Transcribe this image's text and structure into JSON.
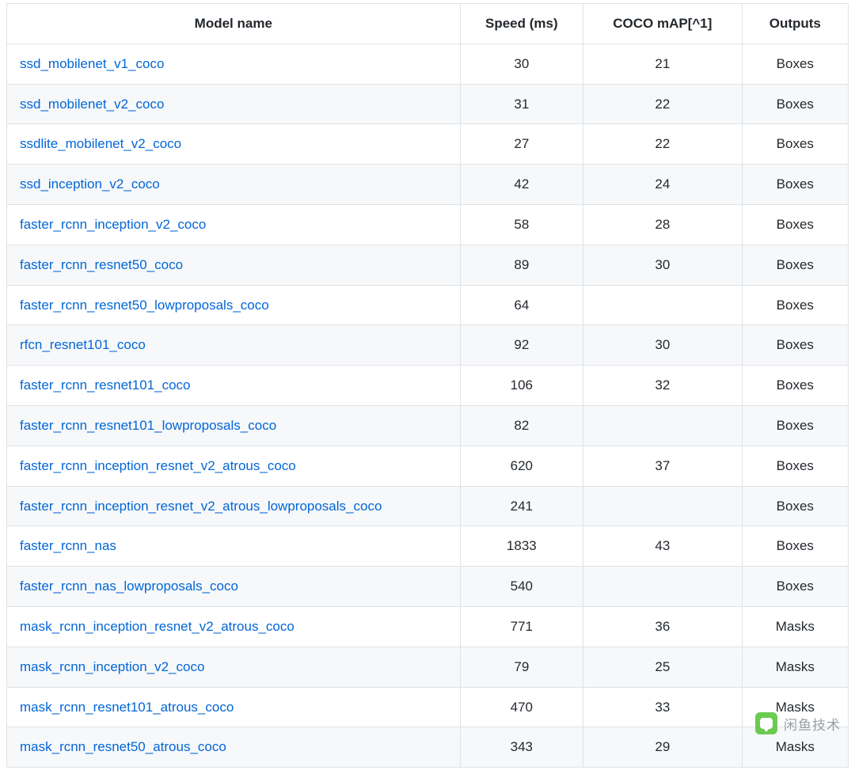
{
  "table": {
    "headers": {
      "name": "Model name",
      "speed": "Speed (ms)",
      "map": "COCO mAP[^1]",
      "outputs": "Outputs"
    },
    "rows": [
      {
        "name": "ssd_mobilenet_v1_coco",
        "speed": "30",
        "map": "21",
        "outputs": "Boxes"
      },
      {
        "name": "ssd_mobilenet_v2_coco",
        "speed": "31",
        "map": "22",
        "outputs": "Boxes"
      },
      {
        "name": "ssdlite_mobilenet_v2_coco",
        "speed": "27",
        "map": "22",
        "outputs": "Boxes"
      },
      {
        "name": "ssd_inception_v2_coco",
        "speed": "42",
        "map": "24",
        "outputs": "Boxes"
      },
      {
        "name": "faster_rcnn_inception_v2_coco",
        "speed": "58",
        "map": "28",
        "outputs": "Boxes"
      },
      {
        "name": "faster_rcnn_resnet50_coco",
        "speed": "89",
        "map": "30",
        "outputs": "Boxes"
      },
      {
        "name": "faster_rcnn_resnet50_lowproposals_coco",
        "speed": "64",
        "map": "",
        "outputs": "Boxes"
      },
      {
        "name": "rfcn_resnet101_coco",
        "speed": "92",
        "map": "30",
        "outputs": "Boxes"
      },
      {
        "name": "faster_rcnn_resnet101_coco",
        "speed": "106",
        "map": "32",
        "outputs": "Boxes"
      },
      {
        "name": "faster_rcnn_resnet101_lowproposals_coco",
        "speed": "82",
        "map": "",
        "outputs": "Boxes"
      },
      {
        "name": "faster_rcnn_inception_resnet_v2_atrous_coco",
        "speed": "620",
        "map": "37",
        "outputs": "Boxes"
      },
      {
        "name": "faster_rcnn_inception_resnet_v2_atrous_lowproposals_coco",
        "speed": "241",
        "map": "",
        "outputs": "Boxes"
      },
      {
        "name": "faster_rcnn_nas",
        "speed": "1833",
        "map": "43",
        "outputs": "Boxes"
      },
      {
        "name": "faster_rcnn_nas_lowproposals_coco",
        "speed": "540",
        "map": "",
        "outputs": "Boxes"
      },
      {
        "name": "mask_rcnn_inception_resnet_v2_atrous_coco",
        "speed": "771",
        "map": "36",
        "outputs": "Masks"
      },
      {
        "name": "mask_rcnn_inception_v2_coco",
        "speed": "79",
        "map": "25",
        "outputs": "Masks"
      },
      {
        "name": "mask_rcnn_resnet101_atrous_coco",
        "speed": "470",
        "map": "33",
        "outputs": "Masks"
      },
      {
        "name": "mask_rcnn_resnet50_atrous_coco",
        "speed": "343",
        "map": "29",
        "outputs": "Masks"
      }
    ]
  },
  "watermark": {
    "text": "闲鱼技术"
  }
}
